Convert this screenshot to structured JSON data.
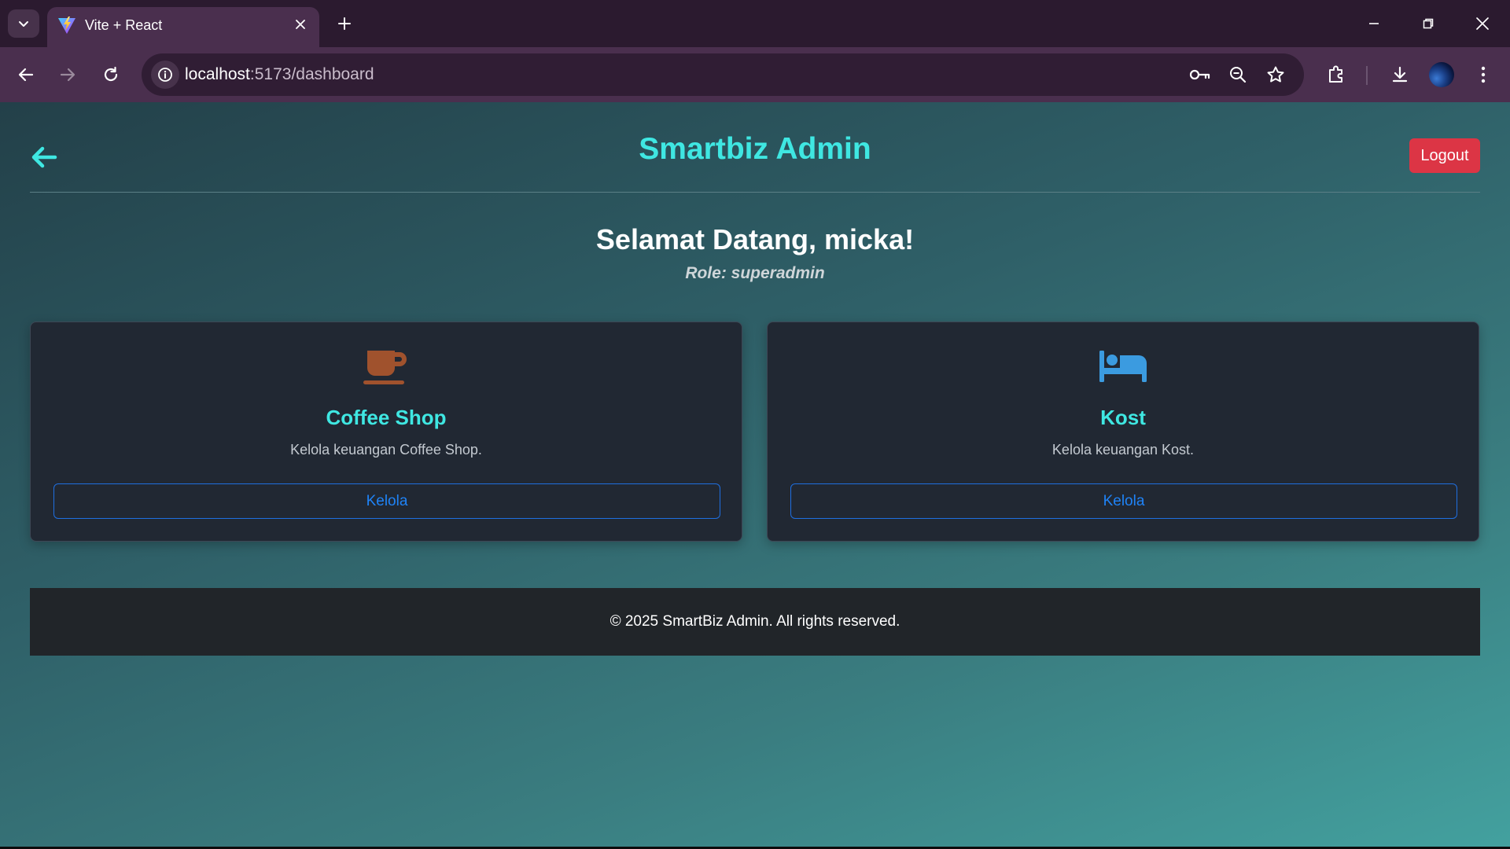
{
  "browser": {
    "tab": {
      "title": "Vite + React",
      "favicon": "vite-logo"
    },
    "url_host": "localhost",
    "url_path": ":5173/dashboard",
    "toolbar_icons": [
      "back-icon",
      "forward-icon",
      "reload-icon",
      "site-info-icon",
      "password-key-icon",
      "zoom-icon",
      "bookmark-star-icon",
      "extensions-icon",
      "download-icon",
      "profile-avatar",
      "menu-icon"
    ]
  },
  "header": {
    "title": "Smartbiz Admin",
    "logout_label": "Logout"
  },
  "welcome": {
    "greeting": "Selamat Datang, micka!",
    "role": "Role: superadmin"
  },
  "cards": [
    {
      "icon": "coffee-cup-icon",
      "icon_color": "#a0522d",
      "title": "Coffee Shop",
      "description": "Kelola keuangan Coffee Shop.",
      "button_label": "Kelola"
    },
    {
      "icon": "bed-icon",
      "icon_color": "#3b9be0",
      "title": "Kost",
      "description": "Kelola keuangan Kost.",
      "button_label": "Kelola"
    }
  ],
  "footer": {
    "text": "© 2025 SmartBiz Admin. All rights reserved."
  },
  "colors": {
    "accent": "#3fe7e2",
    "danger": "#dc3545",
    "primary": "#1f83f7",
    "card_bg": "#212833",
    "footer_bg": "#212529"
  }
}
